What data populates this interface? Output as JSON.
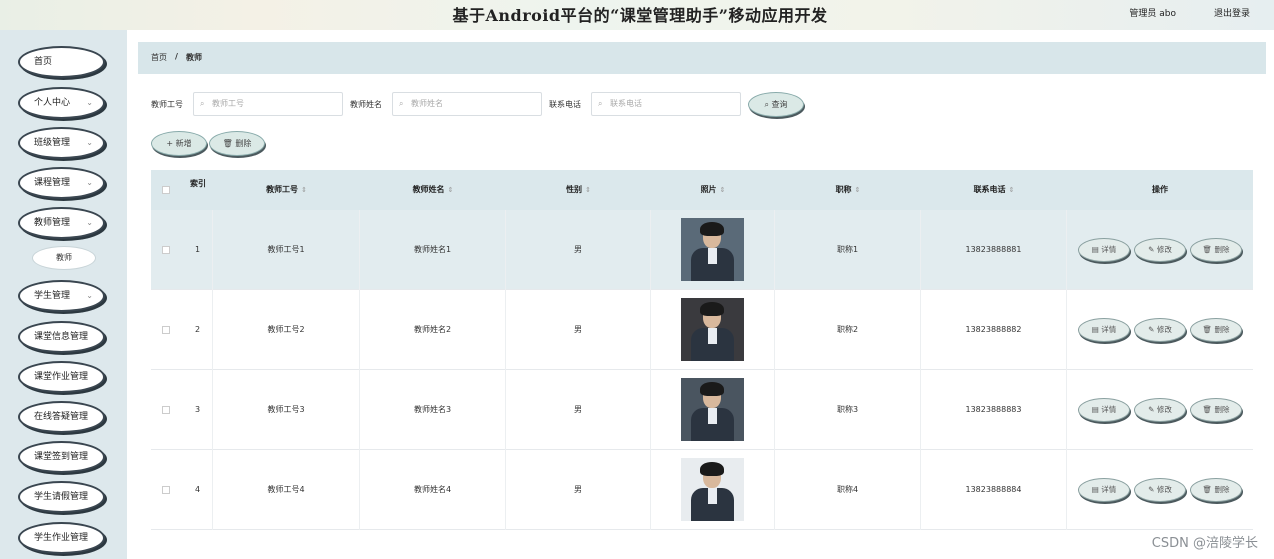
{
  "header": {
    "title": "基于Android平台的“课堂管理助手”移动应用开发",
    "admin": "管理员 abo",
    "logout": "退出登录"
  },
  "sidebar": {
    "items": [
      {
        "label": "首页",
        "chevron": ""
      },
      {
        "label": "个人中心",
        "chevron": "⌄"
      },
      {
        "label": "班级管理",
        "chevron": "⌄"
      },
      {
        "label": "课程管理",
        "chevron": "⌄"
      },
      {
        "label": "教师管理",
        "chevron": "⌄"
      },
      {
        "label": "学生管理",
        "chevron": "⌄"
      },
      {
        "label": "课堂信息管理",
        "chevron": ""
      },
      {
        "label": "课堂作业管理",
        "chevron": ""
      },
      {
        "label": "在线答疑管理",
        "chevron": ""
      },
      {
        "label": "课堂签到管理",
        "chevron": ""
      },
      {
        "label": "学生请假管理",
        "chevron": ""
      },
      {
        "label": "学生作业管理",
        "chevron": ""
      }
    ],
    "sub_item": "教师"
  },
  "breadcrumb": {
    "home": "首页",
    "sep": "/",
    "current": "教师"
  },
  "search": {
    "fields": [
      {
        "label": "教师工号",
        "placeholder": "教师工号"
      },
      {
        "label": "教师姓名",
        "placeholder": "教师姓名"
      },
      {
        "label": "联系电话",
        "placeholder": "联系电话"
      }
    ],
    "query_label": "查询",
    "search_icon": "⌕"
  },
  "actions": {
    "add_label": "+ 新增",
    "delete_label": "🗑 删除"
  },
  "table": {
    "columns": [
      "索引",
      "教师工号",
      "教师姓名",
      "性别",
      "照片",
      "职称",
      "联系电话",
      "操作"
    ],
    "sort_icon": "⇕",
    "rows": [
      {
        "index": "1",
        "id": "教师工号1",
        "name": "教师姓名1",
        "gender": "男",
        "title": "职称1",
        "phone": "13823888881"
      },
      {
        "index": "2",
        "id": "教师工号2",
        "name": "教师姓名2",
        "gender": "男",
        "title": "职称2",
        "phone": "13823888882"
      },
      {
        "index": "3",
        "id": "教师工号3",
        "name": "教师姓名3",
        "gender": "男",
        "title": "职称3",
        "phone": "13823888883"
      },
      {
        "index": "4",
        "id": "教师工号4",
        "name": "教师姓名4",
        "gender": "男",
        "title": "职称4",
        "phone": "13823888884"
      }
    ],
    "row_actions": {
      "detail": "详情",
      "edit": "修改",
      "delete": "删除"
    }
  },
  "watermark": "CSDN @涪陵学长"
}
